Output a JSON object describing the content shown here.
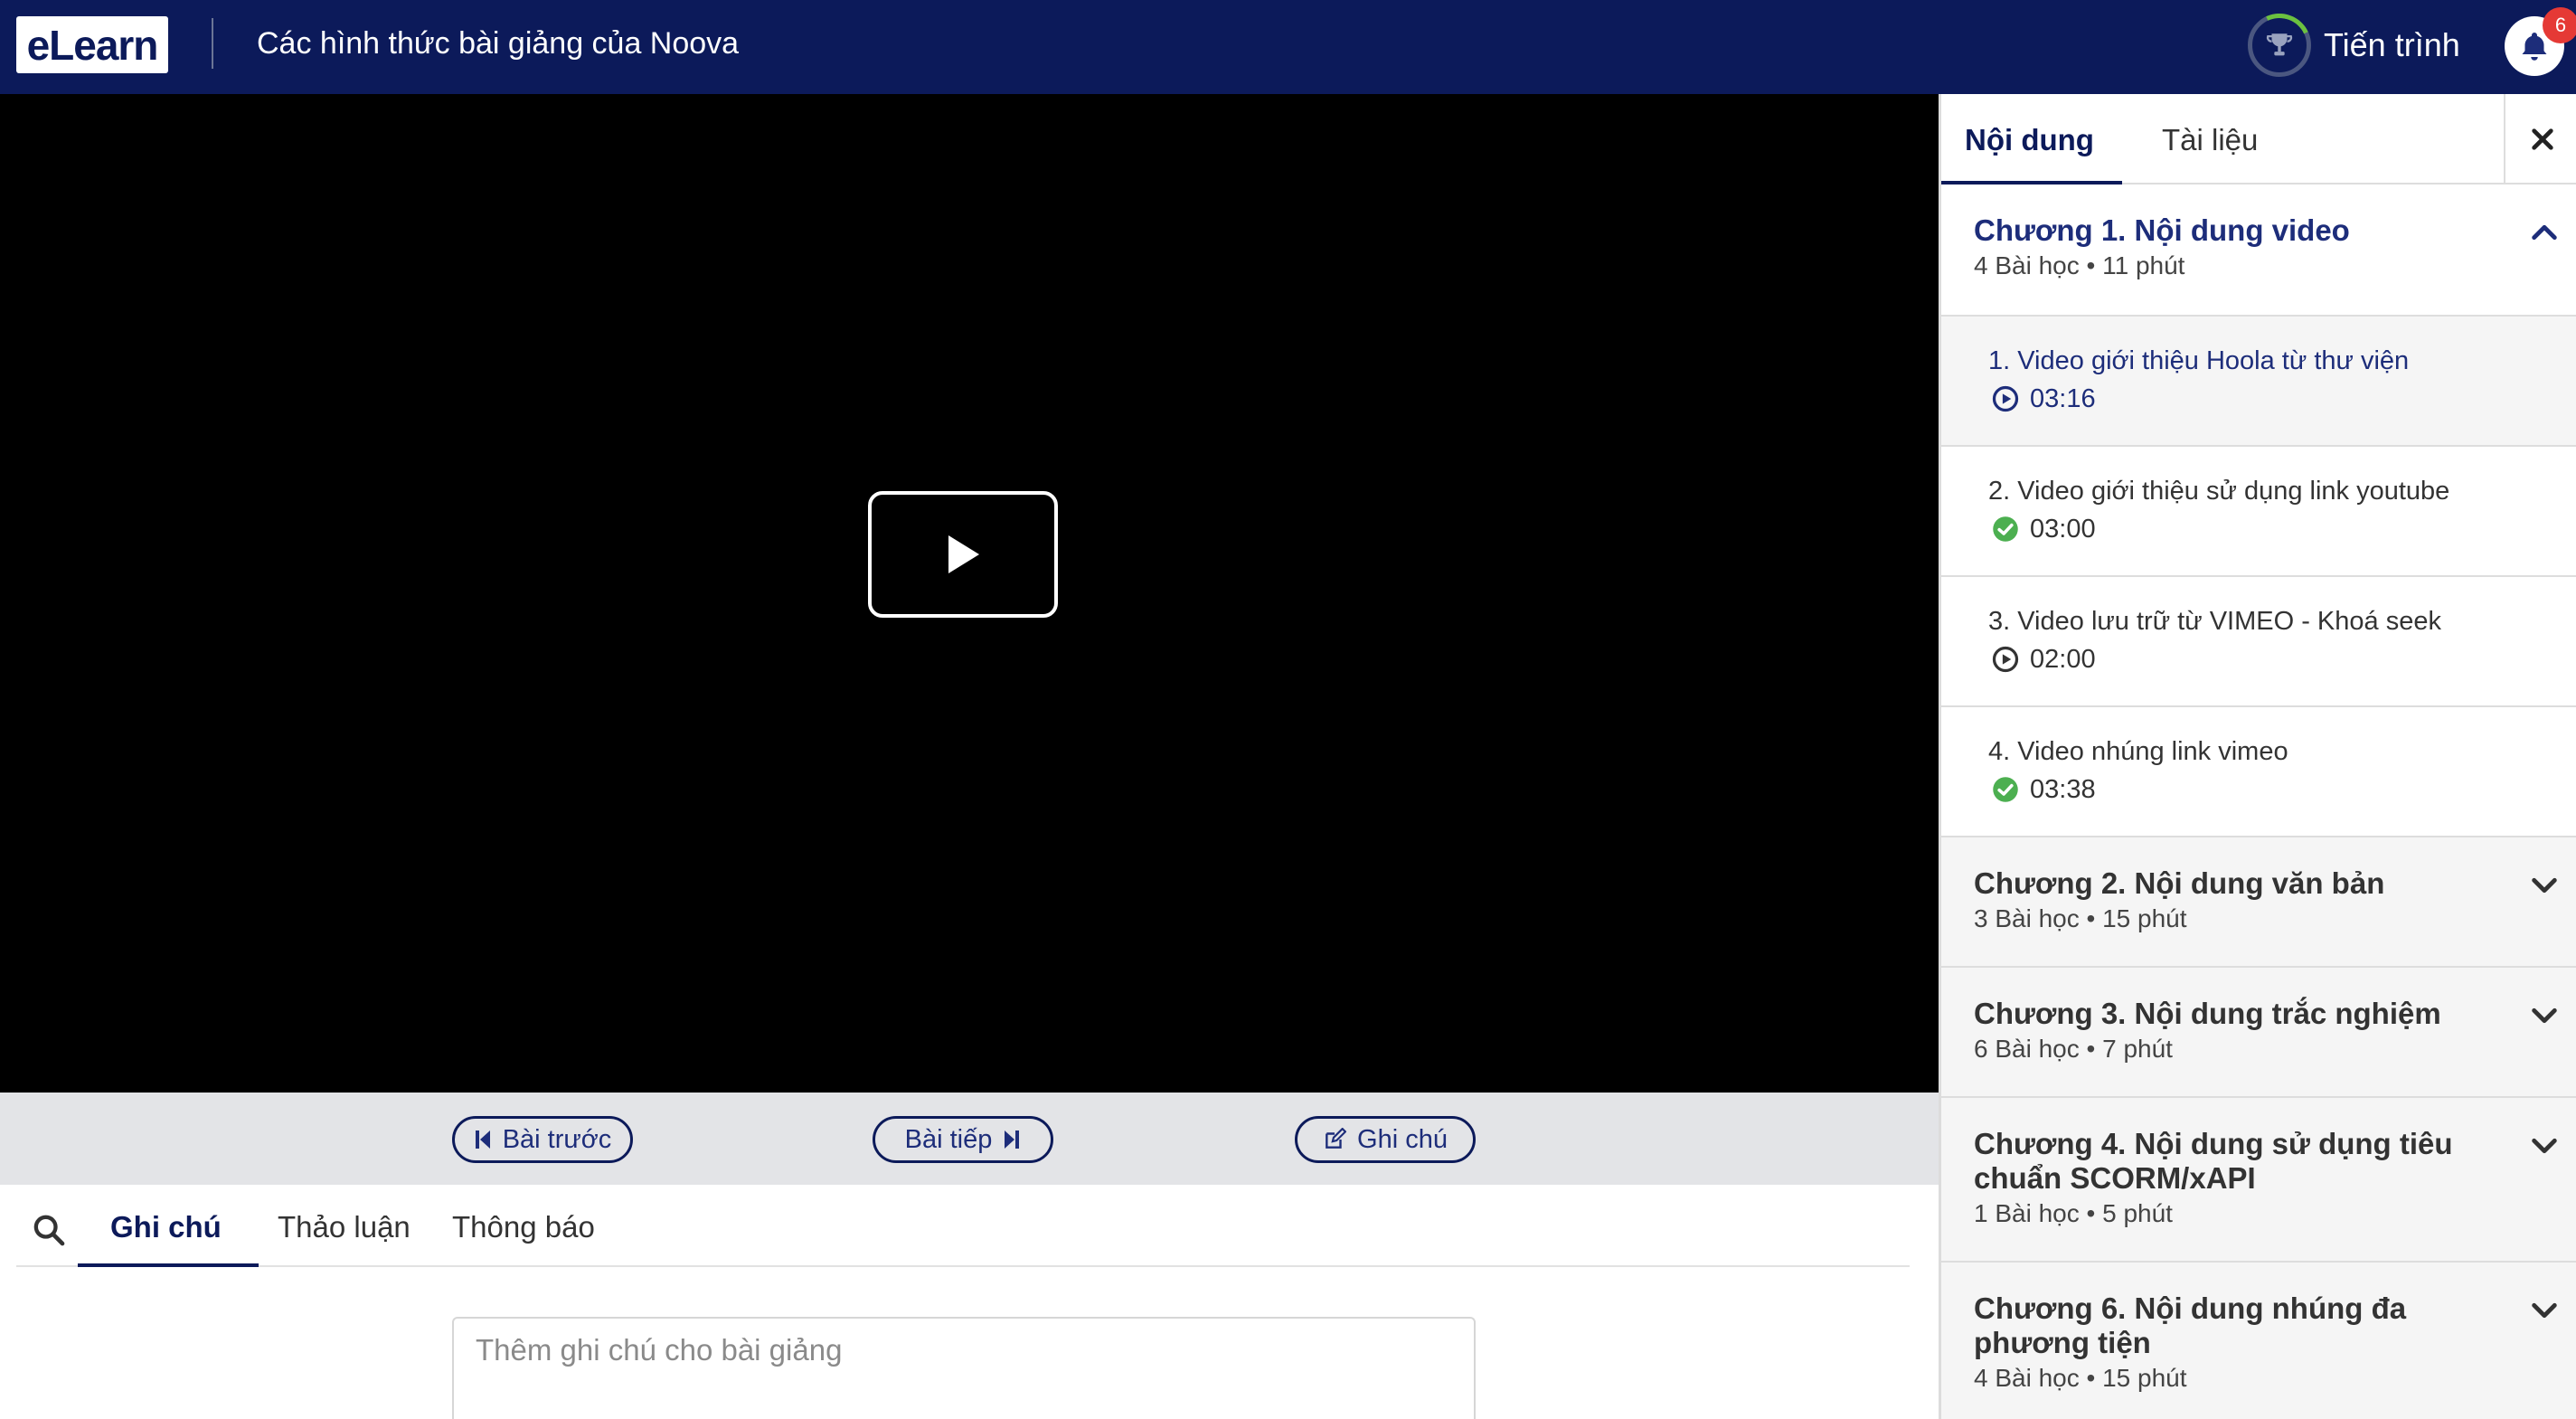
{
  "header": {
    "logo_text": "eLearn",
    "course_title": "Các hình thức bài giảng của Noova",
    "progress_label": "Tiến trình",
    "notification_count": "6",
    "colors": {
      "header_bg": "#0c1a5a",
      "badge": "#e53935",
      "progress_ring": "#6bc13f"
    }
  },
  "player": {
    "play_icon": "play-icon"
  },
  "lesson_nav": {
    "prev_label": "Bài trước",
    "next_label": "Bài tiếp",
    "note_label": "Ghi chú"
  },
  "bottom_tabs": {
    "tabs": [
      "Ghi chú",
      "Thảo luận",
      "Thông báo"
    ],
    "active_index": 0,
    "note_placeholder": "Thêm ghi chú cho bài giảng"
  },
  "sidebar": {
    "tabs": [
      "Nội dung",
      "Tài liệu"
    ],
    "active_index": 0,
    "chapters": [
      {
        "title": "Chương 1. Nội dung video",
        "meta": "4 Bài học • 11 phút",
        "expanded": true,
        "lessons": [
          {
            "title": "1. Video giới thiệu Hoola từ thư viện",
            "duration": "03:16",
            "status": "playing"
          },
          {
            "title": "2. Video giới thiệu sử dụng link youtube",
            "duration": "03:00",
            "status": "completed"
          },
          {
            "title": "3. Video lưu trữ từ VIMEO - Khoá seek",
            "duration": "02:00",
            "status": "not-started"
          },
          {
            "title": "4. Video nhúng link vimeo",
            "duration": "03:38",
            "status": "completed"
          }
        ]
      },
      {
        "title": "Chương 2. Nội dung văn bản",
        "meta": "3 Bài học • 15 phút",
        "expanded": false
      },
      {
        "title": "Chương 3. Nội dung trắc nghiệm",
        "meta": "6 Bài học • 7 phút",
        "expanded": false
      },
      {
        "title_line1": "Chương 4. Nội dung sử dụng tiêu",
        "title_line2": "chuẩn SCORM/xAPI",
        "meta": "1 Bài học • 5 phút",
        "expanded": false
      },
      {
        "title_line1": "Chương 6. Nội dung nhúng đa",
        "title_line2": "phương tiện",
        "meta": "4 Bài học • 15 phút",
        "expanded": false
      }
    ]
  }
}
